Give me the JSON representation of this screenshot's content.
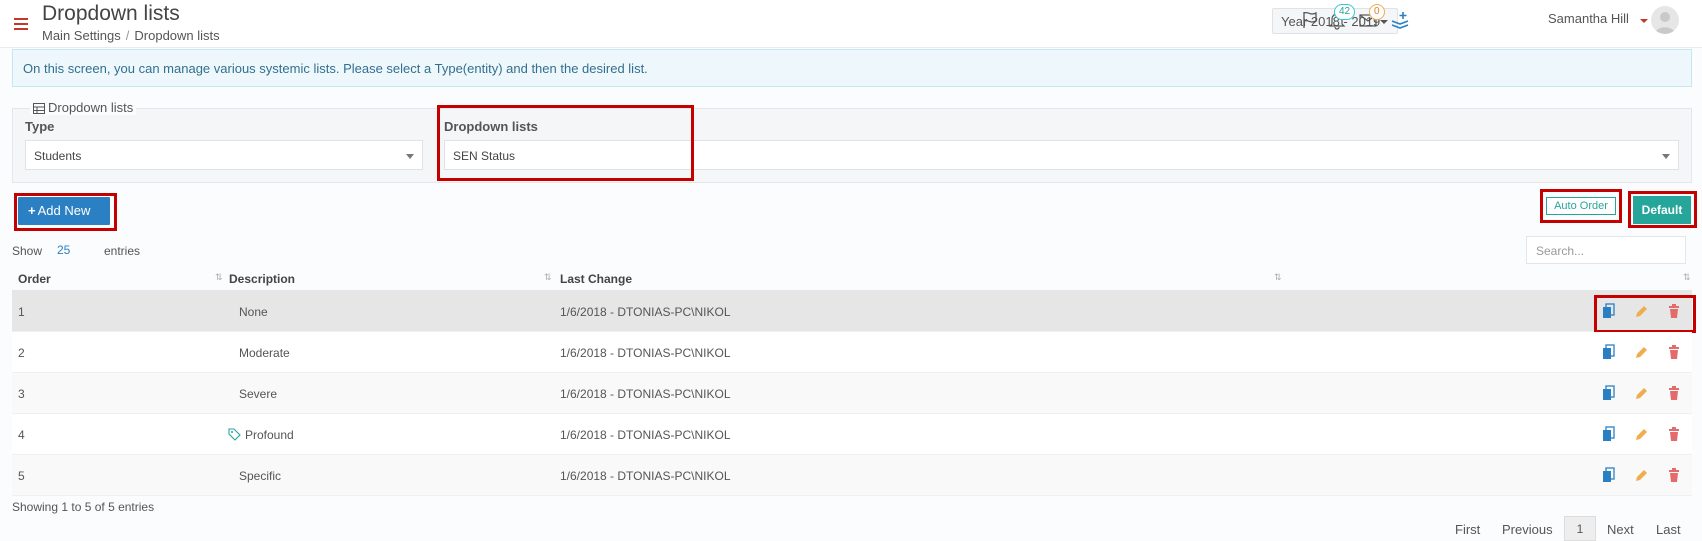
{
  "header": {
    "title": "Dropdown lists",
    "breadcrumb": [
      "Main Settings",
      "Dropdown lists"
    ],
    "year_select": "Year 2018 - 2019",
    "notifications_count": "42",
    "messages_count": "0",
    "user_name": "Samantha Hill"
  },
  "info_note": "On this screen, you can manage various systemic lists. Please select a Type(entity) and then the desired list.",
  "panel": {
    "legend": "Dropdown lists",
    "type_label": "Type",
    "type_value": "Students",
    "list_label": "Dropdown lists",
    "list_value": "SEN Status"
  },
  "buttons": {
    "add_new": "Add New",
    "auto_order": "Auto Order",
    "default": "Default"
  },
  "table_controls": {
    "show_label": "Show",
    "entries_count": "25",
    "entries_label": "entries",
    "search_placeholder": "Search..."
  },
  "table": {
    "columns": [
      "Order",
      "Description",
      "Last Change"
    ],
    "rows": [
      {
        "order": "1",
        "description": "None",
        "last_change": "1/6/2018 - DTONIAS-PC\\NIKOL",
        "tag": false
      },
      {
        "order": "2",
        "description": "Moderate",
        "last_change": "1/6/2018 - DTONIAS-PC\\NIKOL",
        "tag": false
      },
      {
        "order": "3",
        "description": "Severe",
        "last_change": "1/6/2018 - DTONIAS-PC\\NIKOL",
        "tag": false
      },
      {
        "order": "4",
        "description": "Profound",
        "last_change": "1/6/2018 - DTONIAS-PC\\NIKOL",
        "tag": true
      },
      {
        "order": "5",
        "description": "Specific",
        "last_change": "1/6/2018 - DTONIAS-PC\\NIKOL",
        "tag": false
      }
    ]
  },
  "footer": {
    "showing": "Showing 1 to 5 of 5 entries",
    "pager": {
      "first": "First",
      "previous": "Previous",
      "current": "1",
      "next": "Next",
      "last": "Last"
    }
  },
  "icons": {
    "menu": "hamburger-icon",
    "flag": "flag-icon",
    "bell": "bell-icon",
    "mail": "envelope-icon",
    "layers": "layers-plus-icon",
    "copy": "copy-icon",
    "edit": "pencil-icon",
    "delete": "trash-icon",
    "tag": "tag-icon",
    "table": "table-icon"
  },
  "colors": {
    "accent": "#2b7fc3",
    "teal": "#26a69a",
    "danger": "#c0392b",
    "highlight": "#c40000",
    "edit": "#f0ad4e",
    "delete": "#e36b6b"
  }
}
